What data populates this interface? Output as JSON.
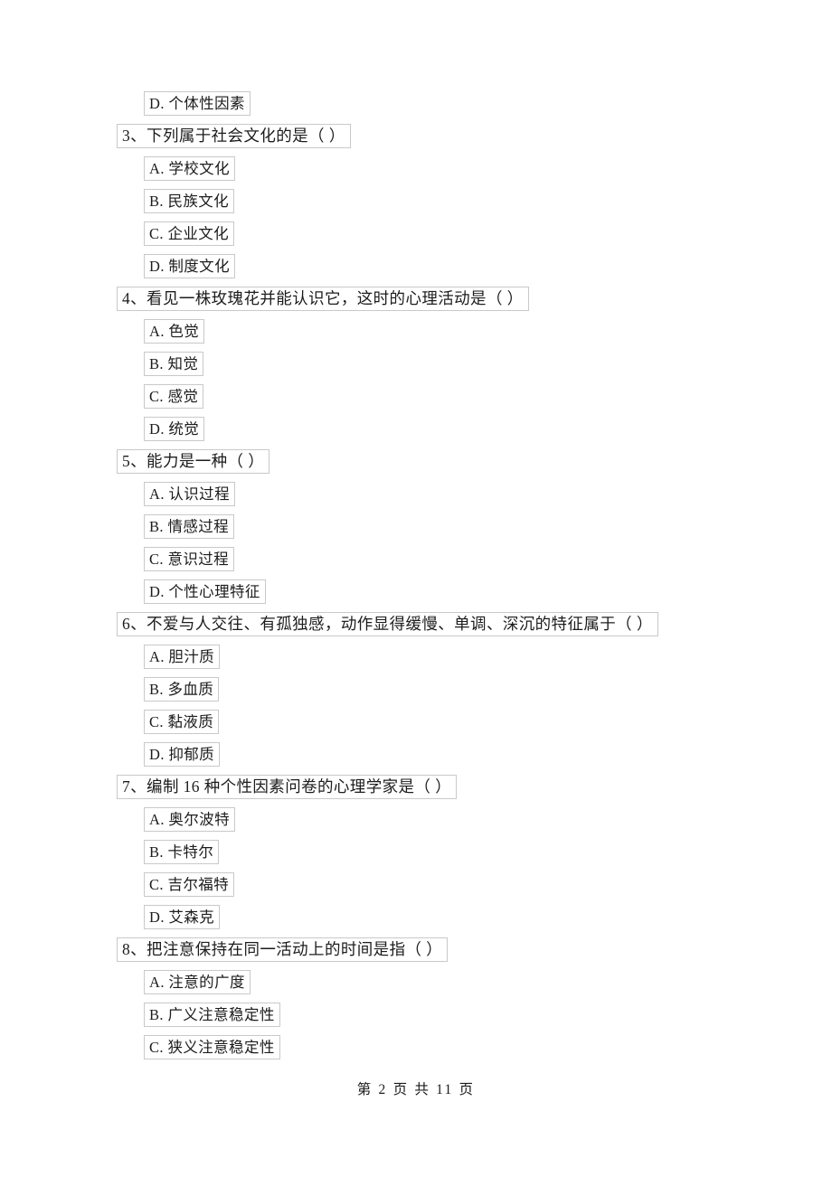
{
  "document": {
    "page_label": "第 2 页 共 11 页",
    "page_number": "2",
    "total_pages": "11",
    "footer_prefix": "第",
    "footer_middle": "页 共",
    "footer_suffix": "页"
  },
  "blocks": [
    {
      "type": "option",
      "text": "D. 个体性因素"
    },
    {
      "type": "question",
      "text": "3、下列属于社会文化的是（      ）"
    },
    {
      "type": "option",
      "text": "A. 学校文化"
    },
    {
      "type": "option",
      "text": "B. 民族文化"
    },
    {
      "type": "option",
      "text": "C. 企业文化"
    },
    {
      "type": "option",
      "text": "D. 制度文化"
    },
    {
      "type": "question",
      "text": "4、看见一株玫瑰花并能认识它，这时的心理活动是（      ）"
    },
    {
      "type": "option",
      "text": "A. 色觉"
    },
    {
      "type": "option",
      "text": "B. 知觉"
    },
    {
      "type": "option",
      "text": "C. 感觉"
    },
    {
      "type": "option",
      "text": "D. 统觉"
    },
    {
      "type": "question",
      "text": "5、能力是一种（      ）"
    },
    {
      "type": "option",
      "text": "A. 认识过程"
    },
    {
      "type": "option",
      "text": "B. 情感过程"
    },
    {
      "type": "option",
      "text": "C. 意识过程"
    },
    {
      "type": "option",
      "text": "D. 个性心理特征"
    },
    {
      "type": "question",
      "text": "6、不爱与人交往、有孤独感，动作显得缓慢、单调、深沉的特征属于（      ）"
    },
    {
      "type": "option",
      "text": "A. 胆汁质"
    },
    {
      "type": "option",
      "text": "B. 多血质"
    },
    {
      "type": "option",
      "text": "C. 黏液质"
    },
    {
      "type": "option",
      "text": "D. 抑郁质"
    },
    {
      "type": "question",
      "text": "7、编制 16 种个性因素问卷的心理学家是（      ）"
    },
    {
      "type": "option",
      "text": "A. 奥尔波特"
    },
    {
      "type": "option",
      "text": "B. 卡特尔"
    },
    {
      "type": "option",
      "text": "C. 吉尔福特"
    },
    {
      "type": "option",
      "text": "D. 艾森克"
    },
    {
      "type": "question",
      "text": "8、把注意保持在同一活动上的时间是指（      ）"
    },
    {
      "type": "option",
      "text": "A. 注意的广度"
    },
    {
      "type": "option",
      "text": "B. 广义注意稳定性"
    },
    {
      "type": "option",
      "text": "C. 狭义注意稳定性"
    }
  ]
}
